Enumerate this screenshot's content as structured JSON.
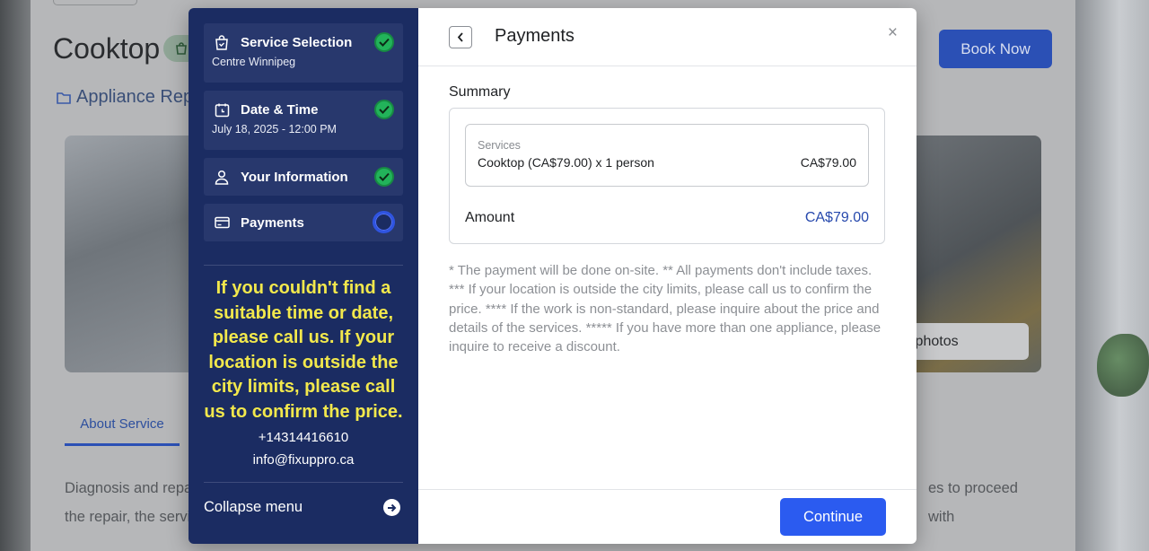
{
  "page": {
    "title": "Cooktop",
    "category": "Appliance Repa",
    "book_now": "Book Now",
    "all_photos": "ll photos",
    "tab_about": "About Service",
    "about_line1_left": "Diagnosis and repa",
    "about_line1_right": "es to proceed with",
    "about_line2_left": "the repair, the servic"
  },
  "modal": {
    "steps": [
      {
        "label": "Service Selection",
        "sub": "Centre Winnipeg",
        "status": "done",
        "icon": "service-icon"
      },
      {
        "label": "Date & Time",
        "sub": "July 18, 2025 - 12:00 PM",
        "status": "done",
        "icon": "calendar-clock-icon"
      },
      {
        "label": "Your Information",
        "sub": "",
        "status": "done",
        "icon": "user-icon"
      },
      {
        "label": "Payments",
        "sub": "",
        "status": "current",
        "icon": "card-icon"
      }
    ],
    "notice": "If you couldn't find a suitable time or date, please call us. If your location is outside the city limits, please call us to confirm the price.",
    "phone": "+14314416610",
    "email": "info@fixuppro.ca",
    "collapse_label": "Collapse menu",
    "title": "Payments",
    "close_glyph": "×",
    "summary_label": "Summary",
    "services_label": "Services",
    "service_line": "Cooktop (CA$79.00) x 1 person",
    "service_price": "CA$79.00",
    "amount_label": "Amount",
    "amount_value": "CA$79.00",
    "notes": "* The payment will be done on-site. ** All payments don't include taxes. *** If your location is outside the city limits, please call us to confirm the price. **** If the work is non-standard, please inquire about the price and details of the services. ***** If you have more than one appliance, please inquire to receive a discount.",
    "continue_label": "Continue"
  },
  "colors": {
    "sidebar_bg": "#1b2c62",
    "notice_yellow": "#f2e84c",
    "primary_blue": "#2b5bf0",
    "check_green": "#22b35a"
  }
}
